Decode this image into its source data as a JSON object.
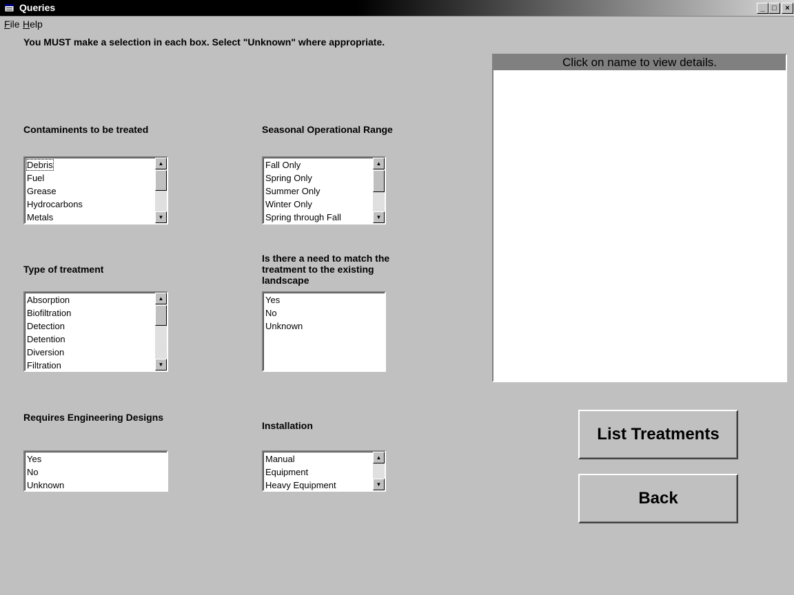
{
  "window": {
    "title": "Queries",
    "icon": "form-icon",
    "controls": {
      "minimize": "_",
      "maximize": "□",
      "close": "×"
    }
  },
  "menu": [
    {
      "label": "File",
      "accel": "F",
      "rest": "ile"
    },
    {
      "label": "Help",
      "accel": "H",
      "rest": "elp"
    }
  ],
  "instructions": "You MUST make a selection in each box.  Select \"Unknown\" where appropriate.",
  "fields": {
    "contaminants": {
      "label": "Contaminents to be treated",
      "items": [
        "Debris",
        "Fuel",
        "Grease",
        "Hydrocarbons",
        "Metals"
      ]
    },
    "seasonal": {
      "label": "Seasonal Operational Range",
      "items": [
        "Fall Only",
        "Spring Only",
        "Summer Only",
        "Winter Only",
        "Spring through Fall"
      ]
    },
    "treatment_type": {
      "label": "Type of treatment",
      "items": [
        "Absorption",
        "Biofiltration",
        "Detection",
        "Detention",
        "Diversion",
        "Filtration"
      ]
    },
    "landscape_match": {
      "label": "Is there a need to match the treatment to the existing landscape",
      "items": [
        "Yes",
        "No",
        "Unknown"
      ]
    },
    "engineering": {
      "label": "Requires Engineering Designs",
      "items": [
        "Yes",
        "No",
        "Unknown"
      ]
    },
    "installation": {
      "label": "Installation",
      "items": [
        "Manual",
        "Equipment",
        "Heavy Equipment"
      ]
    }
  },
  "details": {
    "header": "Click on name to view details."
  },
  "buttons": {
    "list": "List Treatments",
    "back": "Back"
  }
}
